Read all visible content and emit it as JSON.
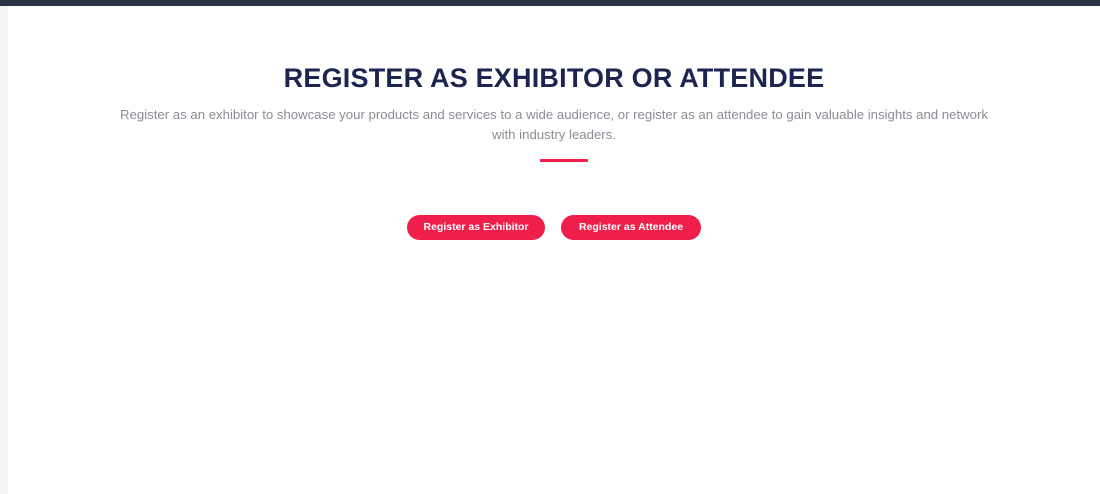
{
  "hero": {
    "title": "REGISTER AS EXHIBITOR OR ATTENDEE",
    "description": "Register as an exhibitor to showcase your products and services to a wide audience, or register as an attendee to gain valuable insights and network with industry leaders."
  },
  "actions": {
    "exhibitor_label": "Register as Exhibitor",
    "attendee_label": "Register as Attendee"
  },
  "colors": {
    "accent": "#ef1e4b",
    "title": "#1b2550",
    "text": "#8a8d96",
    "top_border": "#2b3242"
  }
}
